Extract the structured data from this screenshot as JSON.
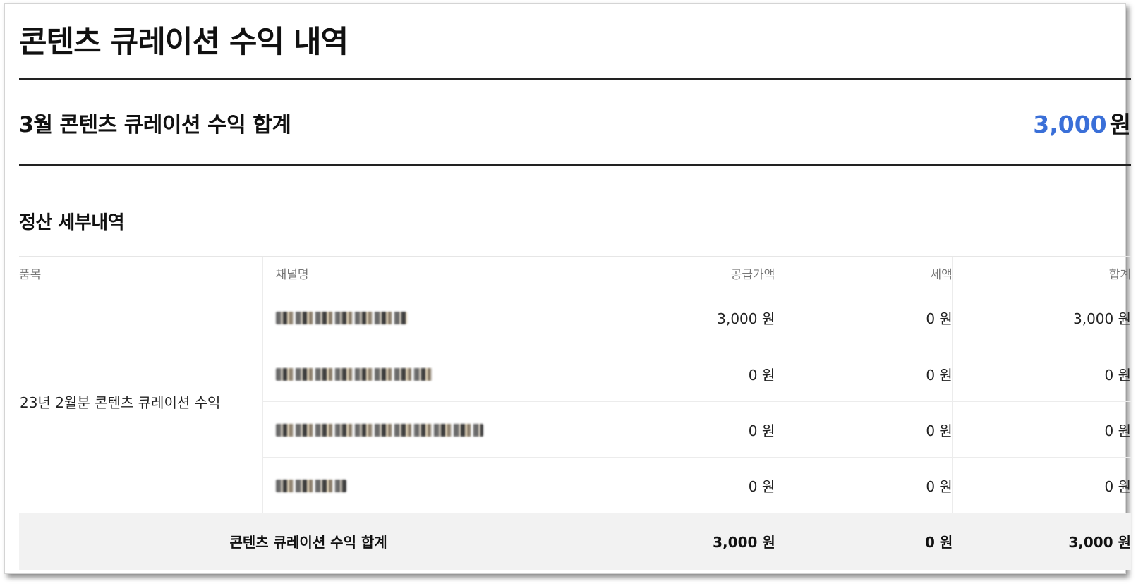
{
  "page": {
    "title": "콘텐츠 큐레이션 수익 내역"
  },
  "summary": {
    "label": "3월 콘텐츠 큐레이션 수익 합계",
    "amount": "3,000",
    "unit": "원",
    "accent_color": "#3a6fd8"
  },
  "details": {
    "section_title": "정산 세부내역",
    "columns": {
      "item": "품목",
      "channel": "채널명",
      "supply": "공급가액",
      "tax": "세액",
      "total": "합계"
    },
    "item_name": "23년 2월분 콘텐츠 큐레이션 수익",
    "rows": [
      {
        "supply": "3,000 원",
        "tax": "0 원",
        "total": "3,000 원"
      },
      {
        "supply": "0 원",
        "tax": "0 원",
        "total": "0 원"
      },
      {
        "supply": "0 원",
        "tax": "0 원",
        "total": "0 원"
      },
      {
        "supply": "0 원",
        "tax": "0 원",
        "total": "0 원"
      }
    ],
    "totals": {
      "label": "콘텐츠 큐레이션 수익 합계",
      "supply": "3,000 원",
      "tax": "0 원",
      "total": "3,000 원"
    }
  }
}
